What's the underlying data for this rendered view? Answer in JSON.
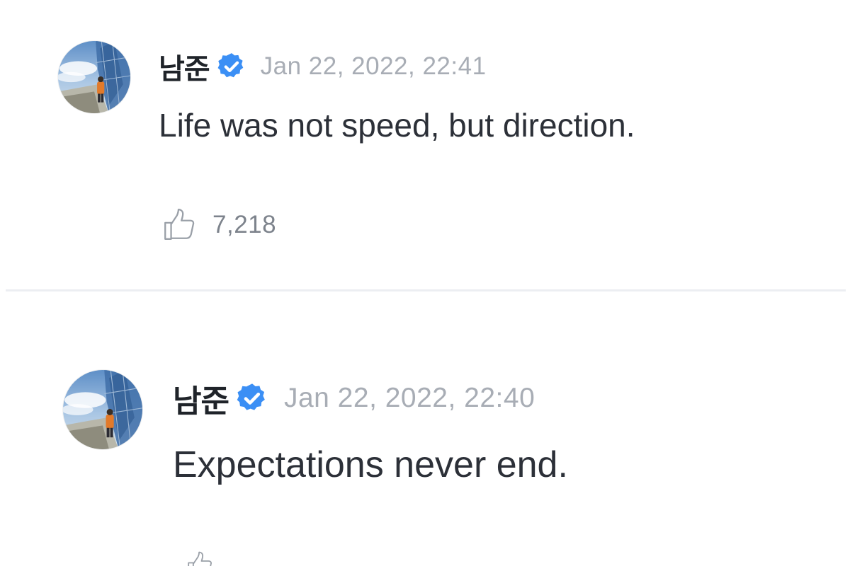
{
  "posts": [
    {
      "author": "남준",
      "verified_icon": "verified-badge-icon",
      "timestamp": "Jan 22, 2022, 22:41",
      "text": "Life was not speed, but direction.",
      "like_icon": "thumbs-up-icon",
      "likes": "7,218"
    },
    {
      "author": "남준",
      "verified_icon": "verified-badge-icon",
      "timestamp": "Jan 22, 2022, 22:40",
      "text": "Expectations never end.",
      "like_icon": "thumbs-up-icon"
    }
  ],
  "colors": {
    "verified_blue": "#3b8ff5",
    "author_text": "#1f2329",
    "timestamp_text": "#a8adb5",
    "body_text": "#2c3038",
    "like_count_text": "#7d838c",
    "divider": "#eceef2",
    "background": "#ffffff"
  }
}
